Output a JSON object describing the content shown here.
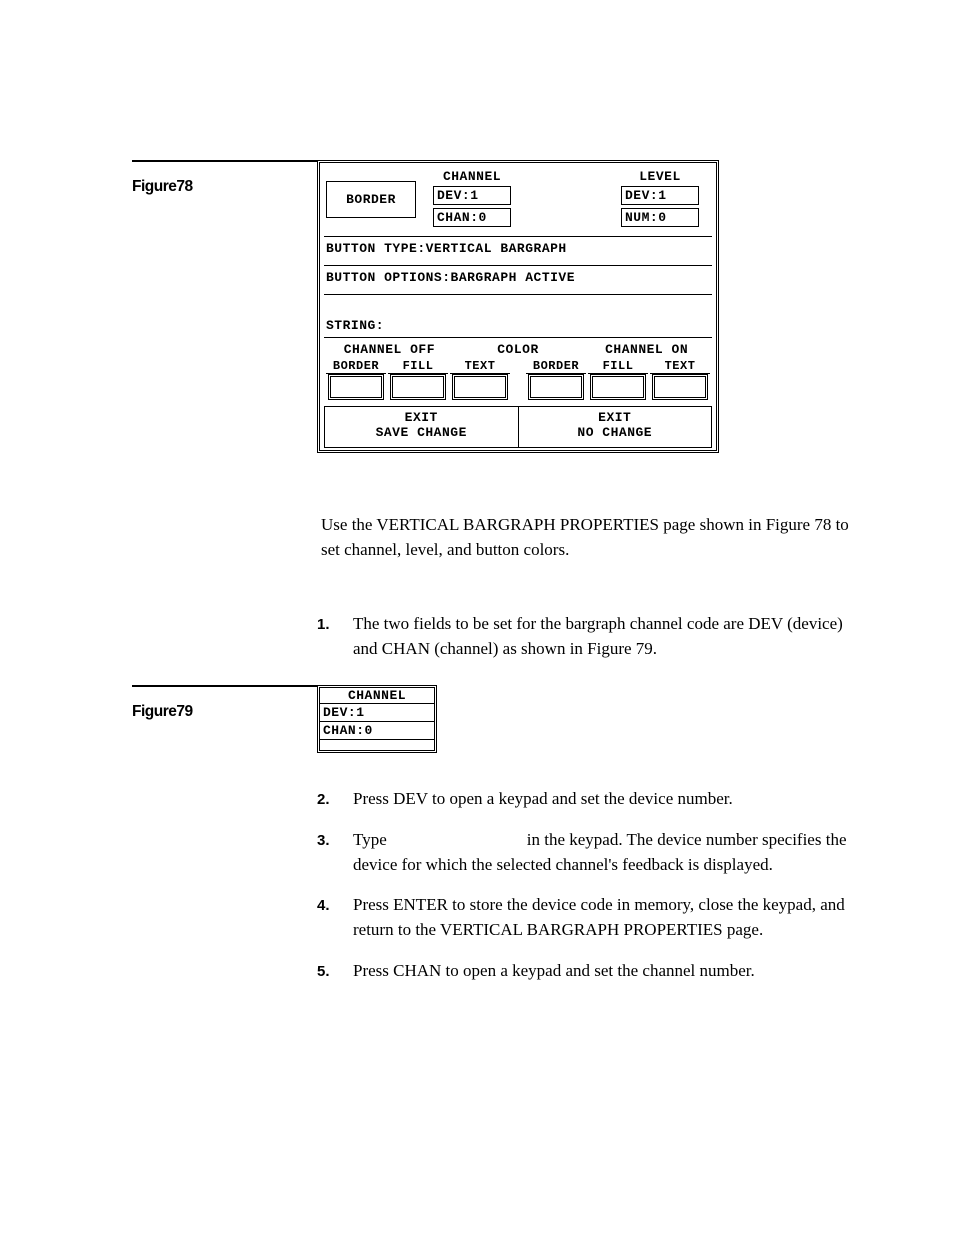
{
  "fig78": {
    "label": "Figure78",
    "border_btn": "BORDER",
    "channel_hdr": "CHANNEL",
    "channel_dev": "DEV:1",
    "channel_chan": "CHAN:0",
    "level_hdr": "LEVEL",
    "level_dev": "DEV:1",
    "level_num": "NUM:0",
    "btn_type": "BUTTON TYPE:VERTICAL BARGRAPH",
    "btn_opts": "BUTTON OPTIONS:BARGRAPH ACTIVE",
    "string": "STRING:",
    "color_title": "COLOR",
    "off_title": "CHANNEL OFF",
    "on_title": "CHANNEL ON",
    "col_border": "BORDER",
    "col_fill": "FILL",
    "col_text": "TEXT",
    "exit_save_l1": "EXIT",
    "exit_save_l2": "SAVE CHANGE",
    "exit_no_l1": "EXIT",
    "exit_no_l2": "NO CHANGE"
  },
  "para1": "Use the VERTICAL BARGRAPH PROPERTIES page shown in Figure 78 to set channel, level, and button colors.",
  "steps": {
    "n1": "1.",
    "t1": "The two fields to be set for the bargraph channel code are DEV (device) and CHAN (channel) as shown in Figure 79.",
    "n2": "2.",
    "t2": "Press DEV to open a keypad and set the device number.",
    "n3": "3.",
    "t3a": "Type",
    "t3b": "in the keypad. The device number specifies the device for which the selected channel's feedback is displayed.",
    "n4": "4.",
    "t4": "Press ENTER to store the device code in memory, close the keypad, and return to the VERTICAL BARGRAPH PROPERTIES page.",
    "n5": "5.",
    "t5": "Press CHAN to open a keypad and set the channel number."
  },
  "fig79": {
    "label": "Figure79",
    "hdr": "CHANNEL",
    "dev": "DEV:1",
    "chan": "CHAN:0"
  }
}
